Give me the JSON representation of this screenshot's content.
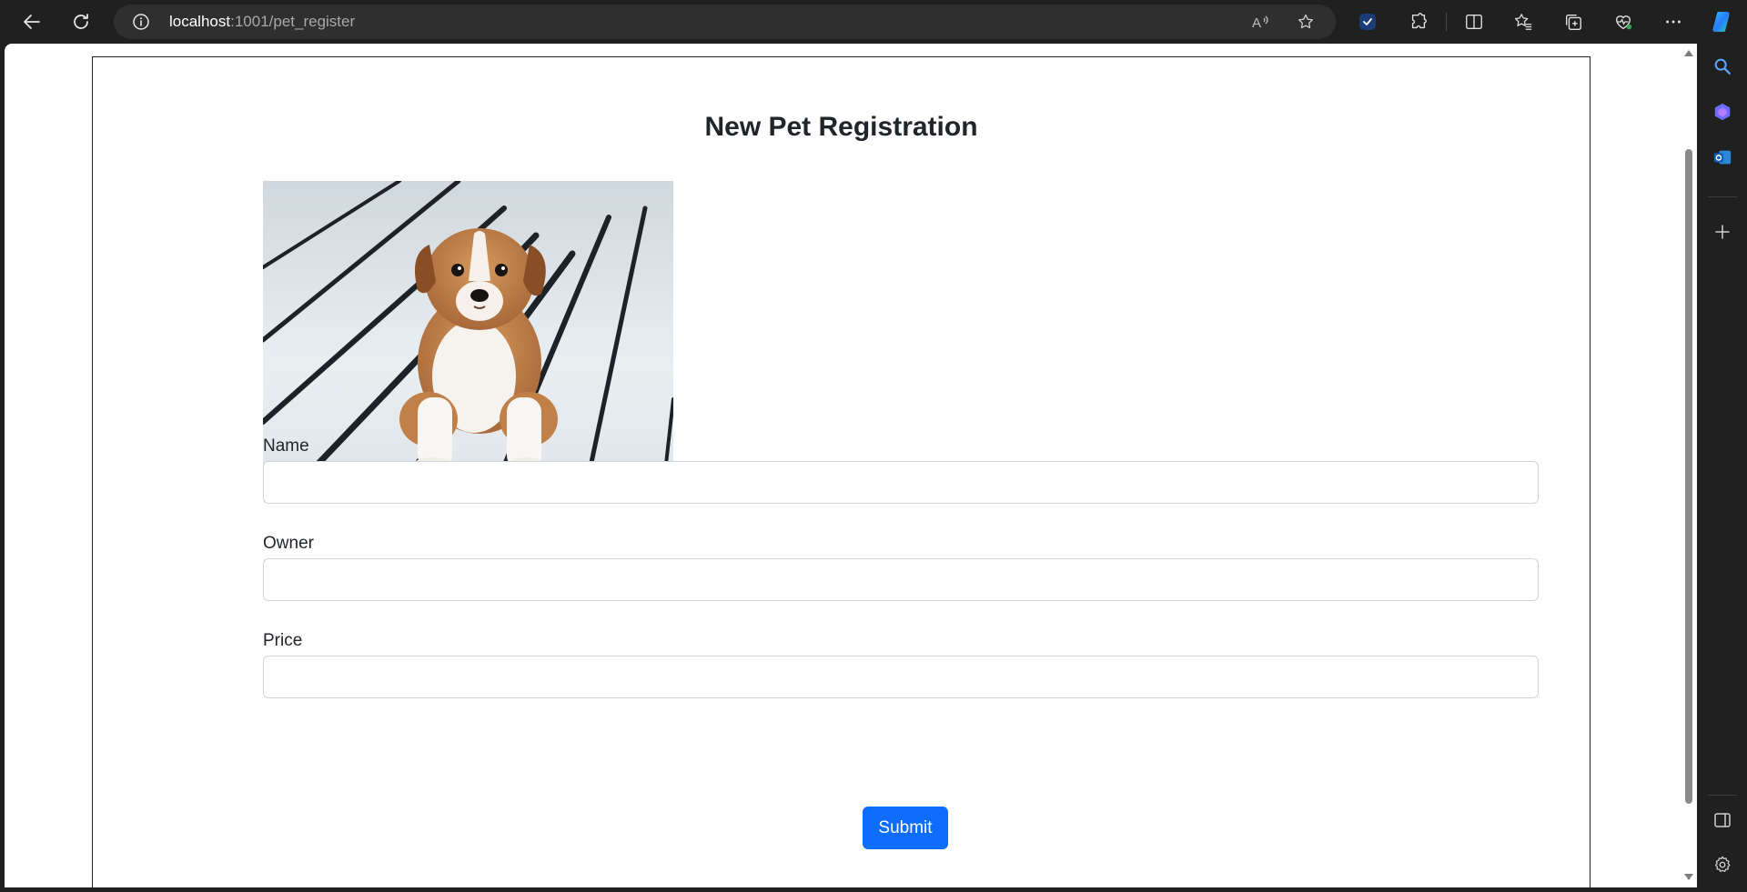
{
  "browser": {
    "url_host": "localhost",
    "url_path": ":1001/pet_register"
  },
  "page": {
    "title": "New Pet Registration",
    "image_subject": "puppy-photo"
  },
  "form": {
    "fields": [
      {
        "label": "Name",
        "value": "",
        "placeholder": ""
      },
      {
        "label": "Owner",
        "value": "",
        "placeholder": ""
      },
      {
        "label": "Price",
        "value": "",
        "placeholder": ""
      }
    ],
    "submit_label": "Submit"
  },
  "colors": {
    "primary": "#0d6efd",
    "browser_chrome": "#202020",
    "page_bg": "#ffffff"
  },
  "icons": {
    "back": "back-arrow-icon",
    "refresh": "refresh-icon",
    "site_info": "info-icon",
    "read_aloud": "read-aloud-icon",
    "favorite": "star-icon",
    "extensions": "puzzle-icon",
    "split": "split-screen-icon",
    "favorites": "favorites-icon",
    "collections": "collections-icon",
    "health": "browser-essentials-icon",
    "more": "more-icon",
    "copilot": "copilot-icon",
    "search": "search-icon",
    "outlook": "outlook-icon",
    "add": "plus-icon",
    "panel": "sidebar-toggle-icon",
    "settings": "gear-icon"
  }
}
